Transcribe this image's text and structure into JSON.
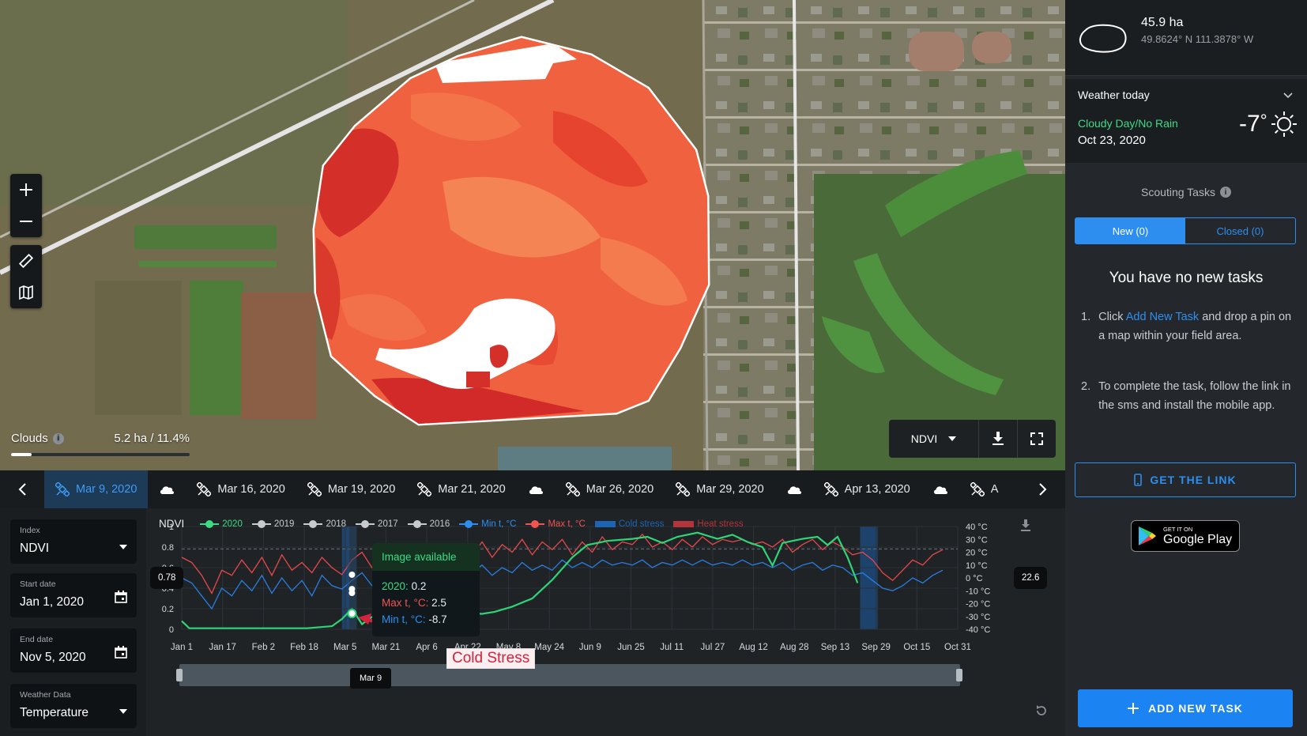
{
  "map": {
    "clouds_label": "Clouds",
    "clouds_info_glyph": "i",
    "clouds_value": "5.2 ha / 11.4%",
    "clouds_fraction": 0.114,
    "index_select": "NDVI"
  },
  "timeline": {
    "items": [
      {
        "type": "image",
        "label": "Mar 9, 2020",
        "active": true
      },
      {
        "type": "cloud"
      },
      {
        "type": "image",
        "label": "Mar 16, 2020"
      },
      {
        "type": "image",
        "label": "Mar 19, 2020"
      },
      {
        "type": "image",
        "label": "Mar 21, 2020"
      },
      {
        "type": "cloud"
      },
      {
        "type": "image",
        "label": "Mar 26, 2020"
      },
      {
        "type": "image",
        "label": "Mar 29, 2020"
      },
      {
        "type": "cloud"
      },
      {
        "type": "image",
        "label": "Apr 13, 2020"
      },
      {
        "type": "cloud"
      },
      {
        "type": "image",
        "label": "A"
      }
    ]
  },
  "filters": {
    "index": {
      "label": "Index",
      "value": "NDVI"
    },
    "start_date": {
      "label": "Start date",
      "value": "Jan 1, 2020"
    },
    "end_date": {
      "label": "End date",
      "value": "Nov 5, 2020"
    },
    "weather": {
      "label": "Weather Data",
      "value": "Temperature"
    }
  },
  "chart": {
    "index_label": "NDVI",
    "legend": [
      {
        "name": "2020",
        "color": "#3ddb84",
        "kind": "line"
      },
      {
        "name": "2019",
        "color": "#c8cbce",
        "kind": "line"
      },
      {
        "name": "2018",
        "color": "#c8cbce",
        "kind": "line"
      },
      {
        "name": "2017",
        "color": "#c8cbce",
        "kind": "line"
      },
      {
        "name": "2016",
        "color": "#c8cbce",
        "kind": "line"
      },
      {
        "name": "Min t, °C",
        "color": "#2d8ef0",
        "kind": "line"
      },
      {
        "name": "Max t, °C",
        "color": "#f05452",
        "kind": "line"
      },
      {
        "name": "Cold stress",
        "color": "#1e64b4",
        "kind": "bar"
      },
      {
        "name": "Heat stress",
        "color": "#b3343a",
        "kind": "bar"
      }
    ],
    "tooltip": {
      "header": "Image available",
      "ndvi_label": "2020:",
      "ndvi_value": "0.2",
      "max_label": "Max t, °C:",
      "max_value": "2.5",
      "min_label": "Min t, °C:",
      "min_value": "-8.7"
    },
    "annotation": "Cold Stress",
    "left_badge": "0.78",
    "right_badge": "22.6",
    "hover_date": "Mar 9"
  },
  "chart_data": {
    "type": "line",
    "xlabel": "",
    "ylabel": "",
    "x_ticks": [
      "Jan 1",
      "Jan 17",
      "Feb 2",
      "Feb 18",
      "Mar 5",
      "Mar 21",
      "Apr 6",
      "Apr 22",
      "May 8",
      "May 24",
      "Jun 9",
      "Jun 25",
      "Jul 11",
      "Jul 27",
      "Aug 12",
      "Aug 28",
      "Sep 13",
      "Sep 29",
      "Oct 15",
      "Oct 31"
    ],
    "y_left_ticks": [
      "0",
      "0.2",
      "0.4",
      "0.6",
      "0.8",
      "1"
    ],
    "y_left_range": [
      0,
      1
    ],
    "y_right_ticks": [
      "40 °C",
      "30 °C",
      "20 °C",
      "10 °C",
      "0 °C",
      "-10 °C",
      "-20 °C",
      "-30 °C",
      "-40 °C"
    ],
    "y_right_range": [
      -40,
      40
    ],
    "days_range": [
      0,
      310
    ],
    "series": [
      {
        "name": "2020",
        "axis": "left",
        "points": [
          [
            0,
            0.08
          ],
          [
            3,
            0.01
          ],
          [
            10,
            0.01
          ],
          [
            30,
            0.01
          ],
          [
            50,
            0.01
          ],
          [
            60,
            0.03
          ],
          [
            64,
            0.1
          ],
          [
            68,
            0.2
          ],
          [
            72,
            0.05
          ],
          [
            76,
            0.12
          ],
          [
            82,
            0.16
          ],
          [
            90,
            0.17
          ],
          [
            100,
            0.17
          ],
          [
            110,
            0.16
          ],
          [
            120,
            0.15
          ],
          [
            125,
            0.17
          ],
          [
            132,
            0.22
          ],
          [
            140,
            0.3
          ],
          [
            148,
            0.48
          ],
          [
            156,
            0.7
          ],
          [
            162,
            0.82
          ],
          [
            170,
            0.86
          ],
          [
            180,
            0.88
          ],
          [
            186,
            0.9
          ],
          [
            192,
            0.84
          ],
          [
            198,
            0.9
          ],
          [
            206,
            0.94
          ],
          [
            214,
            0.88
          ],
          [
            220,
            0.92
          ],
          [
            226,
            0.85
          ],
          [
            232,
            0.8
          ],
          [
            236,
            0.62
          ],
          [
            240,
            0.84
          ],
          [
            248,
            0.88
          ],
          [
            254,
            0.9
          ],
          [
            258,
            0.82
          ],
          [
            262,
            0.9
          ],
          [
            266,
            0.7
          ],
          [
            270,
            0.45
          ]
        ]
      },
      {
        "name": "Max t, °C",
        "axis": "right",
        "points": [
          [
            0,
            16
          ],
          [
            4,
            12
          ],
          [
            8,
            2
          ],
          [
            12,
            -12
          ],
          [
            16,
            6
          ],
          [
            20,
            2
          ],
          [
            24,
            14
          ],
          [
            28,
            4
          ],
          [
            32,
            16
          ],
          [
            36,
            2
          ],
          [
            40,
            18
          ],
          [
            44,
            6
          ],
          [
            48,
            12
          ],
          [
            52,
            4
          ],
          [
            56,
            16
          ],
          [
            60,
            8
          ],
          [
            64,
            2.5
          ],
          [
            68,
            14
          ],
          [
            72,
            20
          ],
          [
            76,
            8
          ],
          [
            80,
            16
          ],
          [
            84,
            12
          ],
          [
            88,
            24
          ],
          [
            92,
            12
          ],
          [
            96,
            26
          ],
          [
            100,
            14
          ],
          [
            104,
            24
          ],
          [
            108,
            16
          ],
          [
            112,
            26
          ],
          [
            116,
            18
          ],
          [
            120,
            28
          ],
          [
            124,
            16
          ],
          [
            128,
            26
          ],
          [
            132,
            20
          ],
          [
            136,
            30
          ],
          [
            140,
            18
          ],
          [
            144,
            28
          ],
          [
            148,
            22
          ],
          [
            152,
            30
          ],
          [
            156,
            18
          ],
          [
            160,
            28
          ],
          [
            164,
            20
          ],
          [
            168,
            32
          ],
          [
            172,
            22
          ],
          [
            176,
            28
          ],
          [
            180,
            26
          ],
          [
            184,
            34
          ],
          [
            188,
            24
          ],
          [
            192,
            28
          ],
          [
            196,
            22
          ],
          [
            200,
            30
          ],
          [
            204,
            24
          ],
          [
            208,
            32
          ],
          [
            212,
            26
          ],
          [
            216,
            30
          ],
          [
            220,
            28
          ],
          [
            224,
            30
          ],
          [
            228,
            26
          ],
          [
            232,
            28
          ],
          [
            236,
            24
          ],
          [
            240,
            30
          ],
          [
            244,
            20
          ],
          [
            248,
            26
          ],
          [
            252,
            30
          ],
          [
            256,
            22
          ],
          [
            260,
            28
          ],
          [
            264,
            24
          ],
          [
            268,
            18
          ],
          [
            272,
            20
          ],
          [
            276,
            14
          ],
          [
            280,
            4
          ],
          [
            284,
            -2
          ],
          [
            288,
            6
          ],
          [
            292,
            14
          ],
          [
            296,
            10
          ],
          [
            300,
            18
          ],
          [
            304,
            22
          ]
        ]
      },
      {
        "name": "Min t, °C",
        "axis": "right",
        "points": [
          [
            0,
            0
          ],
          [
            4,
            -4
          ],
          [
            8,
            -14
          ],
          [
            12,
            -24
          ],
          [
            16,
            -8
          ],
          [
            20,
            -14
          ],
          [
            24,
            -2
          ],
          [
            28,
            -10
          ],
          [
            32,
            2
          ],
          [
            36,
            -12
          ],
          [
            40,
            0
          ],
          [
            44,
            -10
          ],
          [
            48,
            -2
          ],
          [
            52,
            -14
          ],
          [
            56,
            2
          ],
          [
            60,
            -6
          ],
          [
            64,
            -8.7
          ],
          [
            68,
            -2
          ],
          [
            72,
            4
          ],
          [
            76,
            -6
          ],
          [
            80,
            2
          ],
          [
            84,
            -4
          ],
          [
            88,
            6
          ],
          [
            92,
            -2
          ],
          [
            96,
            8
          ],
          [
            100,
            0
          ],
          [
            104,
            6
          ],
          [
            108,
            2
          ],
          [
            112,
            8
          ],
          [
            116,
            4
          ],
          [
            120,
            10
          ],
          [
            124,
            2
          ],
          [
            128,
            8
          ],
          [
            132,
            4
          ],
          [
            136,
            12
          ],
          [
            140,
            6
          ],
          [
            144,
            10
          ],
          [
            148,
            6
          ],
          [
            152,
            14
          ],
          [
            156,
            8
          ],
          [
            160,
            12
          ],
          [
            164,
            8
          ],
          [
            168,
            14
          ],
          [
            172,
            10
          ],
          [
            176,
            12
          ],
          [
            180,
            10
          ],
          [
            184,
            14
          ],
          [
            188,
            8
          ],
          [
            192,
            12
          ],
          [
            196,
            10
          ],
          [
            200,
            14
          ],
          [
            204,
            10
          ],
          [
            208,
            14
          ],
          [
            212,
            10
          ],
          [
            216,
            12
          ],
          [
            220,
            10
          ],
          [
            224,
            14
          ],
          [
            228,
            10
          ],
          [
            232,
            12
          ],
          [
            236,
            8
          ],
          [
            240,
            12
          ],
          [
            244,
            6
          ],
          [
            248,
            10
          ],
          [
            252,
            12
          ],
          [
            256,
            6
          ],
          [
            260,
            10
          ],
          [
            264,
            8
          ],
          [
            268,
            2
          ],
          [
            272,
            4
          ],
          [
            276,
            -2
          ],
          [
            280,
            -8
          ],
          [
            284,
            -10
          ],
          [
            288,
            -6
          ],
          [
            292,
            0
          ],
          [
            296,
            -4
          ],
          [
            300,
            2
          ],
          [
            304,
            6
          ]
        ]
      }
    ],
    "cold_stress_bands": [
      [
        64,
        67
      ],
      [
        271,
        278
      ]
    ],
    "heat_stress_bands": []
  },
  "sidebar": {
    "field": {
      "area": "45.9 ha",
      "coords": "49.8624° N 111.3878° W"
    },
    "weather": {
      "title": "Weather today",
      "condition": "Cloudy Day/No Rain",
      "date": "Oct 23, 2020",
      "temp": "-7",
      "temp_unit": "°"
    },
    "tasks": {
      "title": "Scouting Tasks",
      "info_glyph": "i",
      "tab_new": "New (0)",
      "tab_closed": "Closed (0)",
      "empty_title": "You have no new tasks",
      "step1_num": "1.",
      "step1_pre": "Click ",
      "step1_link": "Add New Task",
      "step1_post": " and drop a pin on a map within your field area.",
      "step2_num": "2.",
      "step2_text": "To complete the task, follow the link in the sms and install the mobile app.",
      "get_link": "GET THE LINK",
      "gplay_small": "GET IT ON",
      "gplay_big": "Google Play",
      "add_task": "ADD NEW TASK"
    }
  }
}
